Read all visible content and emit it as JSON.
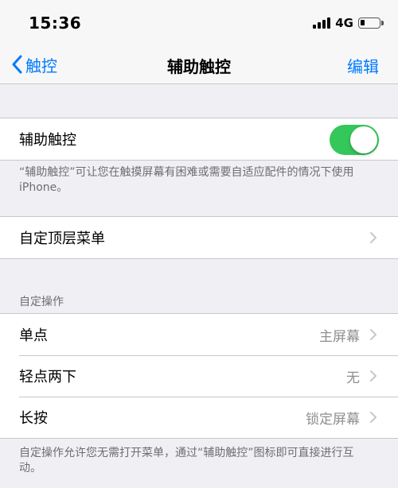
{
  "status_bar": {
    "time": "15:36",
    "network": "4G",
    "icons": [
      "signal-icon",
      "battery-icon"
    ]
  },
  "nav": {
    "back_label": "触控",
    "title": "辅助触控",
    "edit_label": "编辑"
  },
  "assistive_touch": {
    "label": "辅助触控",
    "toggle_on": true,
    "toggle_color": "#34c759",
    "footnote": "“辅助触控”可让您在触摸屏幕有困难或需要自适应配件的情况下使用iPhone。"
  },
  "top_menu": {
    "label": "自定顶层菜单"
  },
  "custom_actions": {
    "header": "自定操作",
    "rows": [
      {
        "label": "单点",
        "value": "主屏幕"
      },
      {
        "label": "轻点两下",
        "value": "无"
      },
      {
        "label": "长按",
        "value": "锁定屏幕"
      }
    ],
    "footnote": "自定操作允许您无需打开菜单，通过“辅助触控”图标即可直接进行互动。"
  },
  "colors": {
    "accent": "#007aff",
    "background": "#efeff4"
  }
}
